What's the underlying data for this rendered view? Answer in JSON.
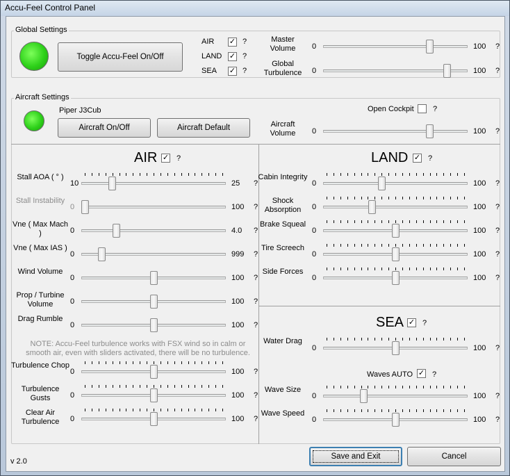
{
  "window": {
    "title": "Accu-Feel Control Panel"
  },
  "global": {
    "legend": "Global Settings",
    "toggle_label": "Toggle Accu-Feel On/Off",
    "checks": [
      {
        "label": "AIR",
        "checked": true
      },
      {
        "label": "LAND",
        "checked": true
      },
      {
        "label": "SEA",
        "checked": true
      }
    ],
    "master": {
      "label": "Master Volume",
      "min": "0",
      "max": "100",
      "value": 75
    },
    "turb": {
      "label": "Global Turbulence",
      "min": "0",
      "max": "100",
      "value": 88
    }
  },
  "aircraft": {
    "legend": "Aircraft Settings",
    "name": "Piper J3Cub",
    "onoff_label": "Aircraft On/Off",
    "default_label": "Aircraft Default",
    "open_cockpit_label": "Open Cockpit",
    "open_cockpit_checked": false,
    "volume": {
      "label": "Aircraft Volume",
      "min": "0",
      "max": "100",
      "value": 75
    }
  },
  "air": {
    "title": "AIR",
    "checked": true,
    "sliders": [
      {
        "label": "Stall AOA ( ° )",
        "min": "10",
        "max": "25",
        "value": 0.2,
        "gray": false
      },
      {
        "label": "Stall Instability",
        "min": "0",
        "max": "100",
        "value": 0,
        "gray": true
      },
      {
        "label": "Vne ( Max Mach )",
        "min": "0",
        "max": "4.0",
        "value": 0.23,
        "gray": false
      },
      {
        "label": "Vne ( Max IAS )",
        "min": "0",
        "max": "999",
        "value": 0.12,
        "gray": false
      },
      {
        "label": "Wind Volume",
        "min": "0",
        "max": "100",
        "value": 0.5,
        "gray": false
      },
      {
        "label": "Prop / Turbine Volume",
        "min": "0",
        "max": "100",
        "value": 0.5,
        "gray": false
      },
      {
        "label": "Drag Rumble",
        "min": "0",
        "max": "100",
        "value": 0.5,
        "gray": false
      }
    ],
    "note": "NOTE: Accu-Feel turbulence works with FSX wind so in calm or smooth air, even with sliders activated, there will be no turbulence.",
    "sliders2": [
      {
        "label": "Turbulence Chop",
        "min": "0",
        "max": "100",
        "value": 0.5
      },
      {
        "label": "Turbulence Gusts",
        "min": "0",
        "max": "100",
        "value": 0.5
      },
      {
        "label": "Clear Air Turbulence",
        "min": "0",
        "max": "100",
        "value": 0.5
      }
    ]
  },
  "land": {
    "title": "LAND",
    "checked": true,
    "sliders": [
      {
        "label": "Cabin Integrity",
        "min": "0",
        "max": "100",
        "value": 0.4
      },
      {
        "label": "Shock Absorption",
        "min": "0",
        "max": "100",
        "value": 0.33
      },
      {
        "label": "Brake Squeal",
        "min": "0",
        "max": "100",
        "value": 0.5
      },
      {
        "label": "Tire Screech",
        "min": "0",
        "max": "100",
        "value": 0.5
      },
      {
        "label": "Side Forces",
        "min": "0",
        "max": "100",
        "value": 0.5
      }
    ]
  },
  "sea": {
    "title": "SEA",
    "checked": true,
    "drag": {
      "label": "Water Drag",
      "min": "0",
      "max": "100",
      "value": 0.5
    },
    "waves_auto_label": "Waves AUTO",
    "waves_auto_checked": true,
    "sliders": [
      {
        "label": "Wave Size",
        "min": "0",
        "max": "100",
        "value": 0.27
      },
      {
        "label": "Wave Speed",
        "min": "0",
        "max": "100",
        "value": 0.5
      }
    ]
  },
  "footer": {
    "version": "v 2.0",
    "save_label": "Save and Exit",
    "cancel_label": "Cancel"
  },
  "help_glyph": "?",
  "check_glyph": "✓",
  "colors": {
    "led": "#2ed11a",
    "accent": "#3c7fb1"
  }
}
